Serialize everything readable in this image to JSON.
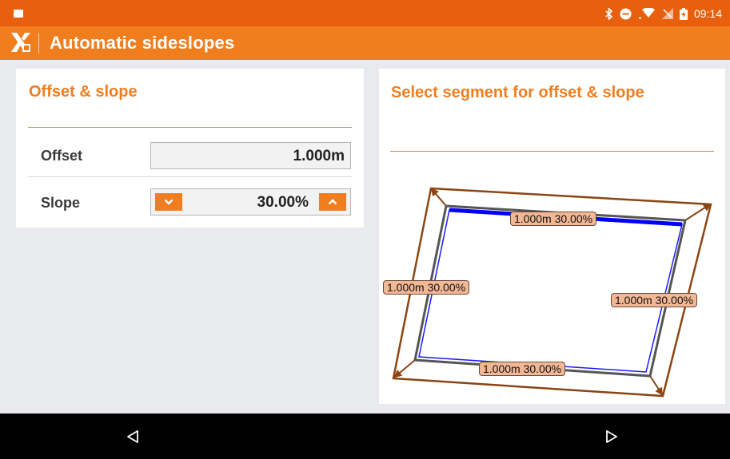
{
  "status_bar": {
    "time": "09:14",
    "icons": [
      "image-icon",
      "bluetooth-icon",
      "do-not-disturb-icon",
      "wifi-icon",
      "no-signal-icon",
      "battery-charging-icon"
    ]
  },
  "app_bar": {
    "logo_icon": "app-logo-icon",
    "title": "Automatic sideslopes"
  },
  "left_panel": {
    "title": "Offset & slope",
    "offset": {
      "label": "Offset",
      "value": "1.000m"
    },
    "slope": {
      "label": "Slope",
      "value": "30.00%",
      "down_icon": "chevron-down-icon",
      "up_icon": "chevron-up-icon"
    }
  },
  "right_panel": {
    "title": "Select segment for offset & slope",
    "segments": {
      "top": "1.000m  30.00%",
      "left": "1.000m  30.00%",
      "right": "1.000m  30.00%",
      "bottom": "1.000m  30.00%"
    }
  },
  "nav_bar": {
    "back_icon": "back-triangle-icon",
    "forward_icon": "forward-triangle-icon"
  },
  "colors": {
    "status_bar": "#e8600e",
    "app_bar": "#f07d1e",
    "accent": "#f07d1e",
    "selected_segment": "#0000ff",
    "slope_lines": "#8b4513",
    "label_bg": "#f2b896"
  }
}
